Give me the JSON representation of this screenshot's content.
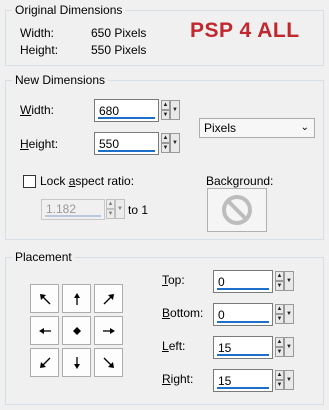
{
  "original": {
    "title": "Original Dimensions",
    "width_label": "Width:",
    "width_value": "650 Pixels",
    "height_label": "Height:",
    "height_value": "550 Pixels"
  },
  "brand": "PSP 4 ALL",
  "new_dim": {
    "title": "New Dimensions",
    "width_label_u": "W",
    "width_label_rest": "idth:",
    "width_value": "680",
    "height_label_u": "H",
    "height_label_rest": "eight:",
    "height_value": "550",
    "units": "Pixels",
    "lock_pre": "Lock ",
    "lock_u": "a",
    "lock_post": "spect ratio:",
    "ratio_value": "1.182",
    "ratio_to": "to 1",
    "background_label": "Background:"
  },
  "placement": {
    "title": "Placement",
    "top_u": "T",
    "top_rest": "op:",
    "top_value": "0",
    "bottom_u": "B",
    "bottom_rest": "ottom:",
    "bottom_value": "0",
    "left_u": "L",
    "left_rest": "eft:",
    "left_value": "15",
    "right_u": "R",
    "right_rest": "ight:",
    "right_value": "15",
    "anchor_icons": [
      "arrow-up-left-icon",
      "arrow-up-icon",
      "arrow-up-right-icon",
      "arrow-left-icon",
      "center-dot-icon",
      "arrow-right-icon",
      "arrow-down-left-icon",
      "arrow-down-icon",
      "arrow-down-right-icon"
    ]
  },
  "colors": {
    "accent": "#1e6fc9",
    "brand": "#c1272d"
  }
}
